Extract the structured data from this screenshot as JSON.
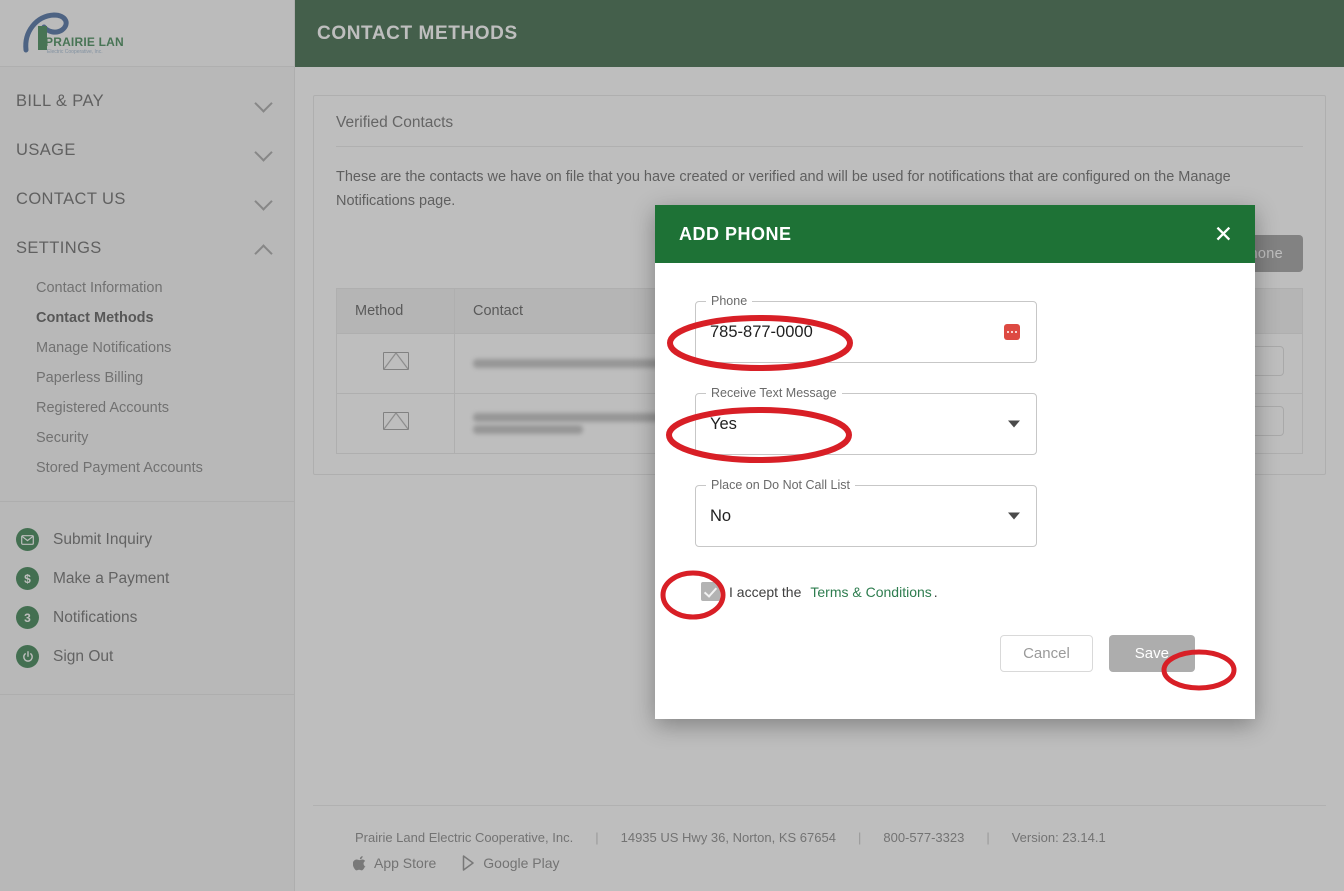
{
  "brand": {
    "logo_name_line1": "PRAIRIE LAND",
    "logo_name_line2": "Electric Cooperative, Inc.",
    "accent_green": "#1e7236",
    "header_green": "#164a23",
    "annotation_red": "#d81f26"
  },
  "header": {
    "title": "CONTACT METHODS"
  },
  "sidebar": {
    "groups": [
      {
        "label": "BILL & PAY",
        "expanded": false,
        "chevron": "chevron-down-icon"
      },
      {
        "label": "USAGE",
        "expanded": false,
        "chevron": "chevron-down-icon"
      },
      {
        "label": "CONTACT US",
        "expanded": false,
        "chevron": "chevron-down-icon"
      },
      {
        "label": "SETTINGS",
        "expanded": true,
        "chevron": "chevron-up-icon"
      }
    ],
    "settings_items": [
      {
        "label": "Contact Information",
        "active": false
      },
      {
        "label": "Contact Methods",
        "active": true
      },
      {
        "label": "Manage Notifications",
        "active": false
      },
      {
        "label": "Paperless Billing",
        "active": false
      },
      {
        "label": "Registered Accounts",
        "active": false
      },
      {
        "label": "Security",
        "active": false
      },
      {
        "label": "Stored Payment Accounts",
        "active": false
      }
    ],
    "quick_links": [
      {
        "label": "Submit Inquiry",
        "icon": "envelope-icon",
        "glyph": "✉"
      },
      {
        "label": "Make a Payment",
        "icon": "dollar-icon",
        "glyph": "$"
      },
      {
        "label": "Notifications",
        "icon": "notification-count-icon",
        "glyph": "3"
      },
      {
        "label": "Sign Out",
        "icon": "power-icon",
        "glyph": "⏻"
      }
    ]
  },
  "main": {
    "card_title": "Verified Contacts",
    "card_description": "These are the contacts we have on file that you have created or verified and will be used for notifications that are configured on the Manage Notifications page.",
    "add_phone_button": "Add Phone",
    "table": {
      "columns": [
        "Method",
        "Contact",
        ""
      ],
      "rows": [
        {
          "method_icon": "envelope-icon",
          "contact": "",
          "redacted": true,
          "redacted_lines": 1
        },
        {
          "method_icon": "envelope-icon",
          "contact": "",
          "redacted": true,
          "redacted_lines": 2
        }
      ]
    }
  },
  "modal": {
    "title": "ADD PHONE",
    "close_icon": "close-icon",
    "fields": {
      "phone": {
        "label": "Phone",
        "value": "785-877-0000",
        "placeholder": "",
        "trailing_icon": "autofill-icon"
      },
      "receive_text": {
        "label": "Receive Text Message",
        "value": "Yes",
        "options": [
          "Yes",
          "No"
        ],
        "icon": "chevron-down-icon"
      },
      "do_not_call": {
        "label": "Place on Do Not Call List",
        "value": "No",
        "options": [
          "Yes",
          "No"
        ],
        "icon": "chevron-down-icon"
      }
    },
    "terms": {
      "checked": true,
      "prefix": "I accept the ",
      "link_text": "Terms & Conditions",
      "suffix": "."
    },
    "buttons": {
      "cancel": "Cancel",
      "save": "Save"
    }
  },
  "footer": {
    "company": "Prairie Land Electric Cooperative, Inc.",
    "address": "14935 US Hwy 36, Norton, KS 67654",
    "phone": "800-577-3323",
    "version": "Version: 23.14.1",
    "separator": "|",
    "stores": [
      {
        "label": "App Store",
        "icon": "apple-icon"
      },
      {
        "label": "Google Play",
        "icon": "google-play-icon"
      }
    ]
  }
}
